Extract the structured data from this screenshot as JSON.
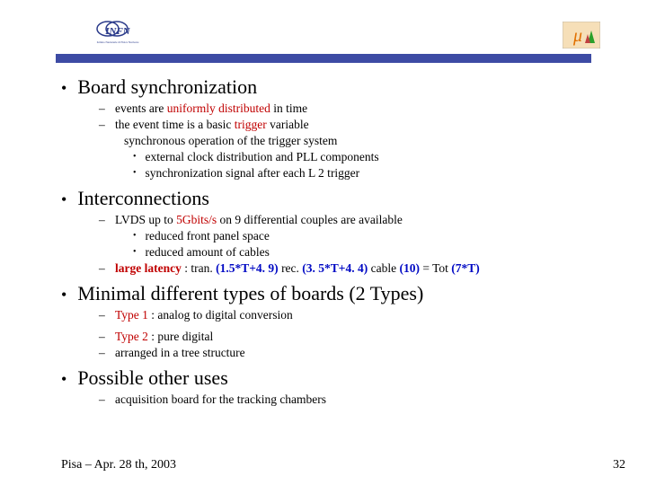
{
  "logos": {
    "infn": "INFN",
    "infn_sub": "Istituto Nazionale di Fisica Nucleare"
  },
  "sections": [
    {
      "heading": "Board synchronization",
      "subs": [
        {
          "pre": "events are ",
          "em1": "uniformly distributed",
          "post1": " in time"
        },
        {
          "pre": "the event time is a basic ",
          "em1": "trigger",
          "post1": " variable"
        }
      ],
      "indent_line": "synchronous operation of the trigger system",
      "subsubs": [
        "external clock distribution and PLL components",
        "synchronization signal after each L 2 trigger"
      ]
    },
    {
      "heading": "Interconnections",
      "sub1_pre": "LVDS up to ",
      "sub1_em": "5Gbits/s",
      "sub1_post": " on 9 differential couples are available",
      "subsubs": [
        "reduced front panel space",
        "reduced amount of cables"
      ],
      "sub2_label": "large latency ",
      "sub2_tran_label": ": tran. ",
      "sub2_tran": "(1.5*T+4. 9)",
      "sub2_rec_label": " rec. ",
      "sub2_rec": "(3. 5*T+4. 4)",
      "sub2_cable_label": " cable ",
      "sub2_cable": "(10)",
      "sub2_tot_label": " = Tot ",
      "sub2_tot": "(7*T)"
    },
    {
      "heading": "Minimal different types of  boards (2 Types)",
      "type1_label": "Type 1 ",
      "type1_desc": ": analog to digital conversion",
      "type2_label": "Type 2 ",
      "type2_desc": ": pure digital",
      "type_tree": "arranged in a tree structure"
    },
    {
      "heading": "Possible other uses",
      "sub": "acquisition board for the tracking chambers"
    }
  ],
  "footer": {
    "left": "Pisa – Apr. 28 th,  2003",
    "right": "32"
  }
}
